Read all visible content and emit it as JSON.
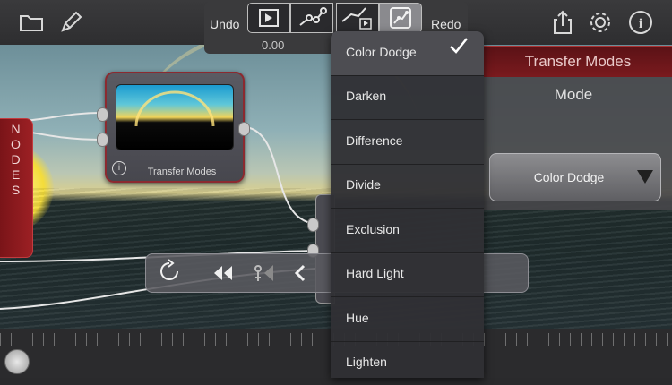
{
  "toolbar": {
    "undo_label": "Undo",
    "redo_label": "Redo",
    "time_value": "0.00",
    "icons": [
      "folder-icon",
      "pencil-icon",
      "play-icon",
      "graph-icon",
      "graph-play-icon",
      "graph-edit-icon",
      "share-icon",
      "gear-icon",
      "info-icon"
    ]
  },
  "side_tab": {
    "label": "NODES"
  },
  "node": {
    "caption": "Transfer Modes"
  },
  "inspector": {
    "title": "Transfer Modes",
    "field_label": "Mode",
    "selected_value": "Color Dodge"
  },
  "dropdown": {
    "selected": "Color Dodge",
    "items": [
      "Color Dodge",
      "Darken",
      "Difference",
      "Divide",
      "Exclusion",
      "Hard Light",
      "Hue",
      "Lighten"
    ]
  },
  "colors": {
    "accent_red": "#8b1a1f",
    "toolbar_bg": "#353537",
    "menu_bg": "#303034"
  }
}
